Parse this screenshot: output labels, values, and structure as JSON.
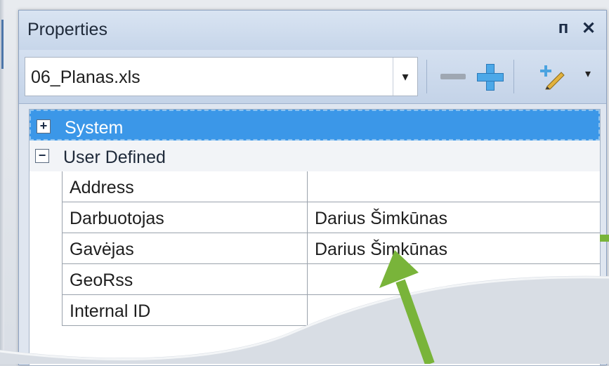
{
  "window": {
    "title": "Properties",
    "pin_glyph": "ᴨ",
    "close_glyph": "✕"
  },
  "toolbar": {
    "selected_file": "06_Planas.xls",
    "dropdown_glyph": "▾",
    "caret_glyph": "▾"
  },
  "groups": [
    {
      "label": "System",
      "expander": "+",
      "selected": true
    },
    {
      "label": "User Defined",
      "expander": "−",
      "selected": false
    }
  ],
  "properties": [
    {
      "name": "Address",
      "value": ""
    },
    {
      "name": "Darbuotojas",
      "value": "Darius Šimkūnas"
    },
    {
      "name": "Gavėjas",
      "value": "Darius Šimkūnas"
    },
    {
      "name": "GeoRss",
      "value": ""
    },
    {
      "name": "Internal ID",
      "value": ""
    }
  ],
  "colors": {
    "selection": "#3b97e8",
    "arrow": "#79b43a",
    "plus_icon": "#4ca8e8"
  },
  "icons": [
    "pin-icon",
    "close-icon",
    "dropdown-arrow-icon",
    "remove-property-icon",
    "add-property-icon",
    "edit-properties-icon",
    "chevron-down-icon",
    "plus-box-icon",
    "minus-box-icon",
    "green-arrow-annotation"
  ]
}
